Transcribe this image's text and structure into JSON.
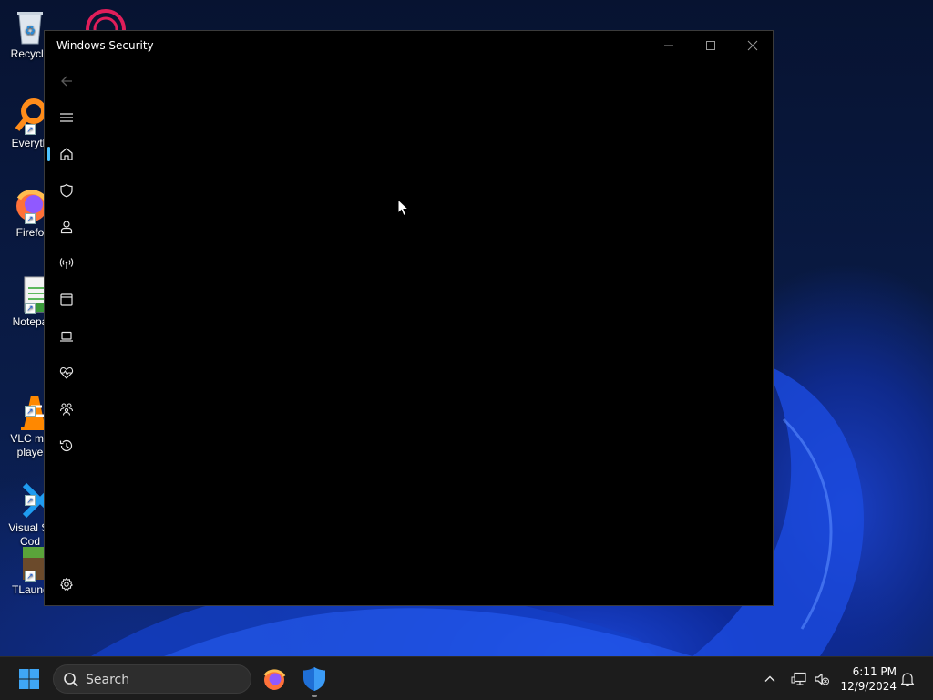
{
  "window": {
    "title": "Windows Security",
    "controls": [
      "minimize",
      "maximize",
      "close"
    ]
  },
  "nav": {
    "back_icon": "back-arrow-icon",
    "menu_icon": "hamburger-menu-icon",
    "items": [
      {
        "id": "home",
        "icon": "home-icon",
        "selected": true
      },
      {
        "id": "virus-protection",
        "icon": "shield-icon",
        "selected": false
      },
      {
        "id": "account-protection",
        "icon": "person-icon",
        "selected": false
      },
      {
        "id": "firewall-network",
        "icon": "antenna-icon",
        "selected": false
      },
      {
        "id": "app-browser-control",
        "icon": "app-window-icon",
        "selected": false
      },
      {
        "id": "device-security",
        "icon": "laptop-icon",
        "selected": false
      },
      {
        "id": "device-performance",
        "icon": "heart-pulse-icon",
        "selected": false
      },
      {
        "id": "family-options",
        "icon": "family-icon",
        "selected": false
      },
      {
        "id": "protection-history",
        "icon": "history-icon",
        "selected": false
      }
    ],
    "settings_icon": "gear-icon"
  },
  "desktop": {
    "icons": [
      {
        "label": "Recycle",
        "icon": "recycle-bin-icon"
      },
      {
        "label": "Everyth",
        "icon": "everything-search-icon"
      },
      {
        "label": "Firefo",
        "icon": "firefox-icon"
      },
      {
        "label": "Notepa",
        "icon": "notepad-icon"
      },
      {
        "label": "VLC me\nplaye",
        "icon": "vlc-icon"
      },
      {
        "label": "Visual St\nCod",
        "icon": "vscode-icon"
      },
      {
        "label": "TLaunc",
        "icon": "tlauncher-icon"
      }
    ]
  },
  "taskbar": {
    "search_label": "Search",
    "time": "6:11 PM",
    "date": "12/9/2024",
    "apps": [
      "firefox-icon",
      "windows-security-icon"
    ]
  },
  "colors": {
    "window_bg": "#000000",
    "accent": "#4cc2ff",
    "taskbar_bg": "#1c1c1c"
  }
}
